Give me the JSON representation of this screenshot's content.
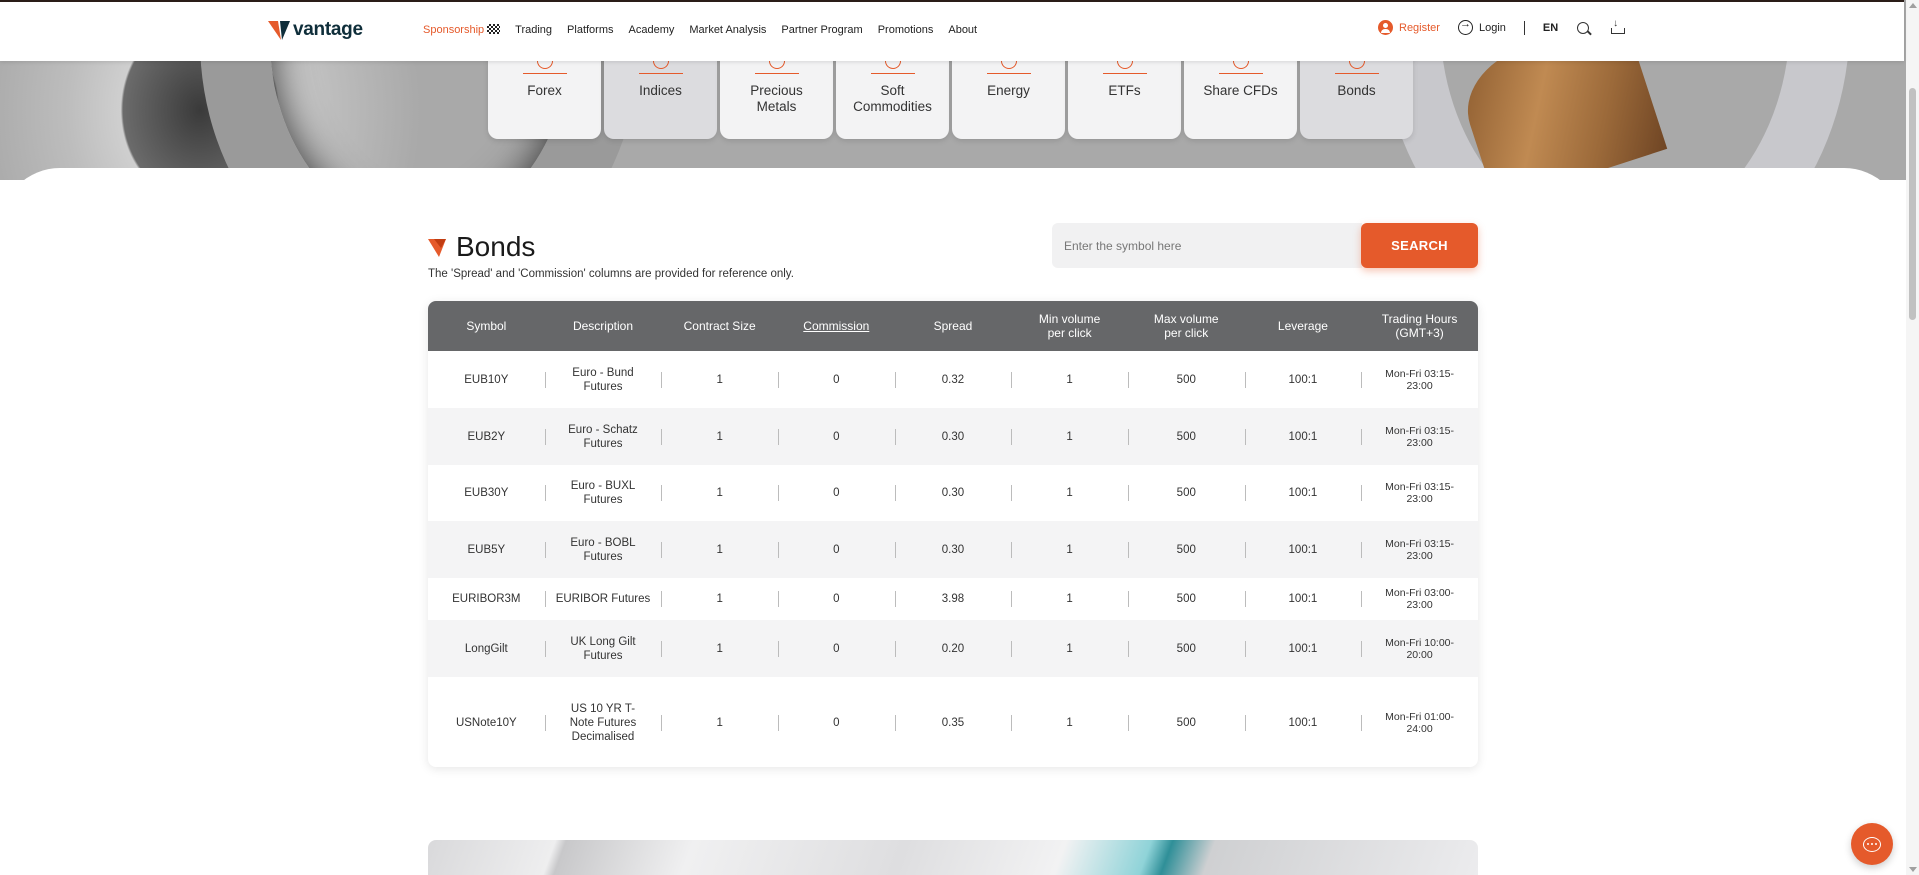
{
  "brand": {
    "name": "vantage",
    "accent": "#e55a2b",
    "dark": "#0f2e3a"
  },
  "nav": {
    "items": [
      {
        "label": "Sponsorship",
        "active": true
      },
      {
        "label": "Trading"
      },
      {
        "label": "Platforms"
      },
      {
        "label": "Academy"
      },
      {
        "label": "Market Analysis"
      },
      {
        "label": "Partner Program"
      },
      {
        "label": "Promotions"
      },
      {
        "label": "About"
      }
    ],
    "register": "Register",
    "login": "Login",
    "language": "EN"
  },
  "categories": [
    {
      "label": "Forex",
      "icon": "forex-icon"
    },
    {
      "label": "Indices",
      "icon": "indices-icon"
    },
    {
      "label": "Precious Metals",
      "icon": "precious-metals-icon"
    },
    {
      "label": "Soft Commodities",
      "icon": "soft-commodities-icon"
    },
    {
      "label": "Energy",
      "icon": "energy-icon"
    },
    {
      "label": "ETFs",
      "icon": "etfs-icon"
    },
    {
      "label": "Share CFDs",
      "icon": "share-cfds-icon"
    },
    {
      "label": "Bonds",
      "icon": "bonds-icon",
      "selected": true
    }
  ],
  "section": {
    "title": "Bonds",
    "note": "The 'Spread' and 'Commission' columns are provided for reference only.",
    "search_placeholder": "Enter the symbol here",
    "search_button": "SEARCH"
  },
  "table": {
    "headers": [
      "Symbol",
      "Description",
      "Contract Size",
      "Commission",
      "Spread",
      "Min volume per click",
      "Max volume per click",
      "Leverage",
      "Trading Hours (GMT+3)"
    ],
    "rows": [
      [
        "EUB10Y",
        "Euro - Bund Futures",
        "1",
        "0",
        "0.32",
        "1",
        "500",
        "100:1",
        "Mon-Fri 03:15-23:00"
      ],
      [
        "EUB2Y",
        "Euro - Schatz Futures",
        "1",
        "0",
        "0.30",
        "1",
        "500",
        "100:1",
        "Mon-Fri 03:15-23:00"
      ],
      [
        "EUB30Y",
        "Euro - BUXL Futures",
        "1",
        "0",
        "0.30",
        "1",
        "500",
        "100:1",
        "Mon-Fri 03:15-23:00"
      ],
      [
        "EUB5Y",
        "Euro - BOBL Futures",
        "1",
        "0",
        "0.30",
        "1",
        "500",
        "100:1",
        "Mon-Fri 03:15-23:00"
      ],
      [
        "EURIBOR3M",
        "EURIBOR Futures",
        "1",
        "0",
        "3.98",
        "1",
        "500",
        "100:1",
        "Mon-Fri 03:00-23:00"
      ],
      [
        "LongGilt",
        "UK Long Gilt Futures",
        "1",
        "0",
        "0.20",
        "1",
        "500",
        "100:1",
        "Mon-Fri 10:00-20:00"
      ],
      [
        "USNote10Y",
        "US 10 YR T-Note Futures Decimalised",
        "1",
        "0",
        "0.35",
        "1",
        "500",
        "100:1",
        "Mon-Fri 01:00-24:00"
      ]
    ]
  },
  "icons": {
    "register": "user-icon",
    "login": "login-icon",
    "search": "search-icon",
    "download": "download-icon",
    "chat": "chat-icon"
  }
}
